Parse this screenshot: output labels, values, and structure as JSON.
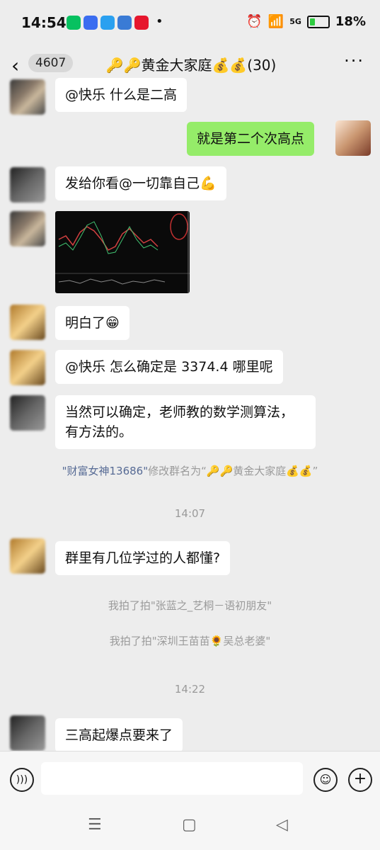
{
  "status": {
    "time": "14:54",
    "battery": "18%",
    "network": "5G"
  },
  "header": {
    "back_count": "4607",
    "title": "🔑🔑黄金大家庭💰💰(30)",
    "more": "···"
  },
  "messages": [
    {
      "side": "left",
      "text": "@快乐  什么是二高"
    },
    {
      "side": "right",
      "text": "就是第二个次高点"
    },
    {
      "side": "left",
      "text": "发给你看@一切靠自己💪"
    },
    {
      "side": "left",
      "type": "image",
      "text": ""
    },
    {
      "side": "left",
      "text": "明白了😁"
    },
    {
      "side": "left",
      "text": "@快乐  怎么确定是 3374.4 哪里呢"
    },
    {
      "side": "left",
      "text": "当然可以确定，老师教的数学测算法，\n有方法的。"
    },
    {
      "side": "left",
      "text": "群里有几位学过的人都懂?"
    },
    {
      "side": "left",
      "text": "三高起爆点要来了"
    }
  ],
  "system": {
    "rename_name": "\"财富女神13686\"",
    "rename_text": "修改群名为“🔑🔑黄金大家庭💰💰”",
    "time1": "14:07",
    "pat1": "我拍了拍\"张蓝之_艺桐－语初朋友\"",
    "pat2": "我拍了拍\"深圳王苗苗🌻吴总老婆\"",
    "time2": "14:22"
  },
  "colors": {
    "bg": "#ededed",
    "bubble_self": "#95ec69",
    "bubble_other": "#ffffff",
    "link": "#576b95"
  }
}
